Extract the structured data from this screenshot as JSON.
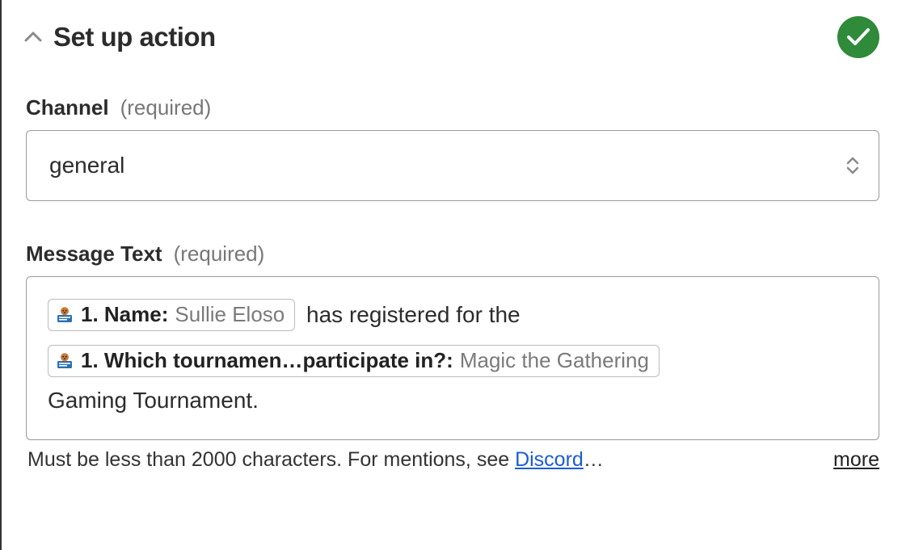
{
  "header": {
    "title": "Set up action"
  },
  "fields": {
    "channel": {
      "label": "Channel",
      "required_text": "(required)",
      "value": "general"
    },
    "message": {
      "label": "Message Text",
      "required_text": "(required)",
      "tokens": {
        "name": {
          "label": "1. Name:",
          "value": "Sullie Eloso"
        },
        "tournament": {
          "label": "1. Which tournamen…participate in?:",
          "value": "Magic the Gathering"
        }
      },
      "plain": {
        "mid": " has registered for the ",
        "end": "Gaming Tournament."
      },
      "helper": {
        "text_a": "Must be less than 2000 characters. For mentions, see ",
        "link": "Discord",
        "ellipsis": "…",
        "more": "more"
      }
    }
  }
}
